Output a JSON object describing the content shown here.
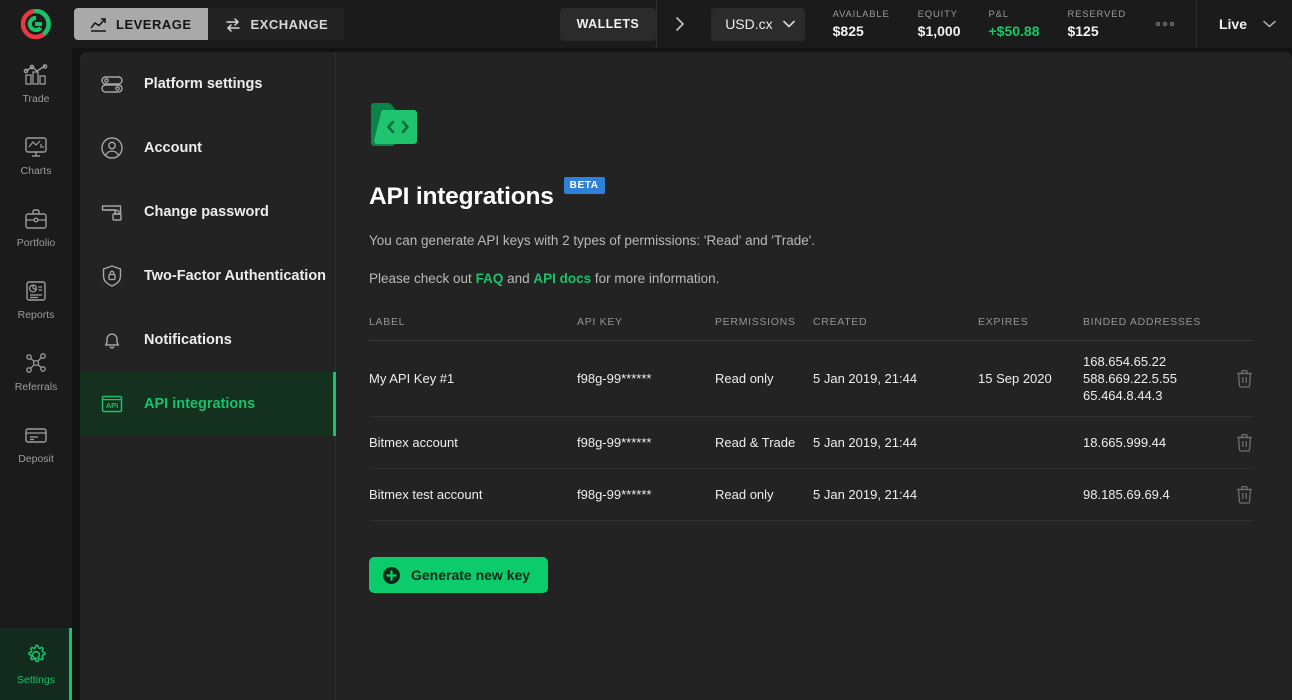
{
  "topbar": {
    "logo": "cex-logo",
    "segments": [
      {
        "label": "LEVERAGE",
        "icon": "trend-up-icon",
        "active": true
      },
      {
        "label": "EXCHANGE",
        "icon": "swap-icon",
        "active": false
      }
    ],
    "wallets_label": "WALLETS",
    "chevron_right": "chevron-right-icon",
    "currency": "USD.cx",
    "stats": [
      {
        "key": "AVAILABLE",
        "value": "$825",
        "positive": false
      },
      {
        "key": "EQUITY",
        "value": "$1,000",
        "positive": false
      },
      {
        "key": "P&L",
        "value": "+$50.88",
        "positive": true
      },
      {
        "key": "RESERVED",
        "value": "$125",
        "positive": false
      }
    ],
    "more_label": "more-options",
    "mode_label": "Live"
  },
  "rail": {
    "items": [
      {
        "label": "Trade",
        "icon": "trade-icon",
        "active": false
      },
      {
        "label": "Charts",
        "icon": "charts-icon",
        "active": false
      },
      {
        "label": "Portfolio",
        "icon": "portfolio-icon",
        "active": false
      },
      {
        "label": "Reports",
        "icon": "reports-icon",
        "active": false
      },
      {
        "label": "Referrals",
        "icon": "referrals-icon",
        "active": false
      },
      {
        "label": "Deposit",
        "icon": "deposit-icon",
        "active": false
      }
    ],
    "bottom": {
      "label": "Settings",
      "icon": "gear-icon",
      "active": true
    }
  },
  "settings_menu": {
    "items": [
      {
        "label": "Platform settings",
        "icon": "sliders-icon",
        "active": false
      },
      {
        "label": "Account",
        "icon": "user-circle-icon",
        "active": false
      },
      {
        "label": "Change password",
        "icon": "password-lock-icon",
        "active": false
      },
      {
        "label": "Two-Factor Authentication",
        "icon": "shield-lock-icon",
        "active": false
      },
      {
        "label": "Notifications",
        "icon": "bell-icon",
        "active": false
      },
      {
        "label": "API integrations",
        "icon": "api-box-icon",
        "active": true
      }
    ]
  },
  "main": {
    "header_icon": "code-folder-icon",
    "title": "API integrations",
    "badge": "BETA",
    "description": "You can generate API keys with 2 types of permissions: 'Read' and 'Trade'.",
    "help_prefix": "Please check out ",
    "help_link1": "FAQ",
    "help_mid": " and ",
    "help_link2": "API docs",
    "help_suffix": " for more information.",
    "table": {
      "columns": [
        "LABEL",
        "API KEY",
        "PERMISSIONS",
        "CREATED",
        "EXPIRES",
        "BINDED ADDRESSES"
      ],
      "rows": [
        {
          "label": "My API Key #1",
          "api_key": "f98g-99******",
          "permissions": "Read only",
          "created": "5 Jan 2019, 21:44",
          "expires": "15 Sep 2020",
          "addresses": [
            "168.654.65.22",
            "588.669.22.5.55",
            "65.464.8.44.3"
          ],
          "delete_icon": "trash-icon"
        },
        {
          "label": "Bitmex account",
          "api_key": "f98g-99******",
          "permissions": "Read & Trade",
          "created": "5 Jan 2019, 21:44",
          "expires": "",
          "addresses": [
            "18.665.999.44"
          ],
          "delete_icon": "trash-icon"
        },
        {
          "label": "Bitmex test account",
          "api_key": "f98g-99******",
          "permissions": "Read only",
          "created": "5 Jan 2019, 21:44",
          "expires": "",
          "addresses": [
            "98.185.69.69.4"
          ],
          "delete_icon": "trash-icon"
        }
      ]
    },
    "generate_button": {
      "label": "Generate new key",
      "icon": "plus-circle-icon"
    }
  },
  "colors": {
    "accent_green": "#19c26a",
    "button_green": "#0ccb6a",
    "badge_blue": "#2f80d8",
    "positive": "#17c964",
    "logo_red": "#e8383d"
  }
}
